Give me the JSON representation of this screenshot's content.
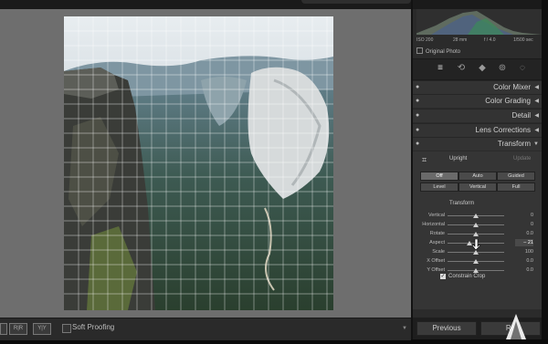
{
  "toolbar_bottom": {
    "view_a": "R|R",
    "view_b": "Y|Y",
    "soft_proofing": "Soft Proofing"
  },
  "histogram": {
    "iso": "ISO 200",
    "focal": "28 mm",
    "aperture": "f / 4.0",
    "shutter": "1/500 sec",
    "original_photo": "Original Photo"
  },
  "tools": [
    {
      "name": "edit",
      "glyph": "⚙"
    },
    {
      "name": "crop",
      "glyph": "⟲"
    },
    {
      "name": "heal",
      "glyph": "✎"
    },
    {
      "name": "redeye",
      "glyph": "◎"
    },
    {
      "name": "masking",
      "glyph": "◌"
    }
  ],
  "sections": {
    "color_mixer": "Color Mixer",
    "color_grading": "Color Grading",
    "detail": "Detail",
    "lens_corrections": "Lens Corrections",
    "transform": "Transform"
  },
  "transform": {
    "upright_label": "Upright",
    "update_label": "Update",
    "row1": [
      "Off",
      "Auto",
      "Guided"
    ],
    "row2": [
      "Level",
      "Vertical",
      "Full"
    ],
    "subtitle": "Transform",
    "sliders": [
      {
        "label": "Vertical",
        "value": "0",
        "pos": 0.5
      },
      {
        "label": "Horizontal",
        "value": "0",
        "pos": 0.5
      },
      {
        "label": "Rotate",
        "value": "0.0",
        "pos": 0.5
      },
      {
        "label": "Aspect",
        "value": "– 21",
        "pos": 0.38
      },
      {
        "label": "Scale",
        "value": "100",
        "pos": 0.5
      },
      {
        "label": "X Offset",
        "value": "0.0",
        "pos": 0.5
      },
      {
        "label": "Y Offset",
        "value": "0.0",
        "pos": 0.5
      }
    ],
    "constrain_crop": "Constrain Crop"
  },
  "nav": {
    "previous": "Previous",
    "reset": "Re"
  },
  "colors": {
    "panel_bg": "#2b2b2b",
    "canvas_bg": "#6e6e6e",
    "accent": "#d0d0d0"
  }
}
